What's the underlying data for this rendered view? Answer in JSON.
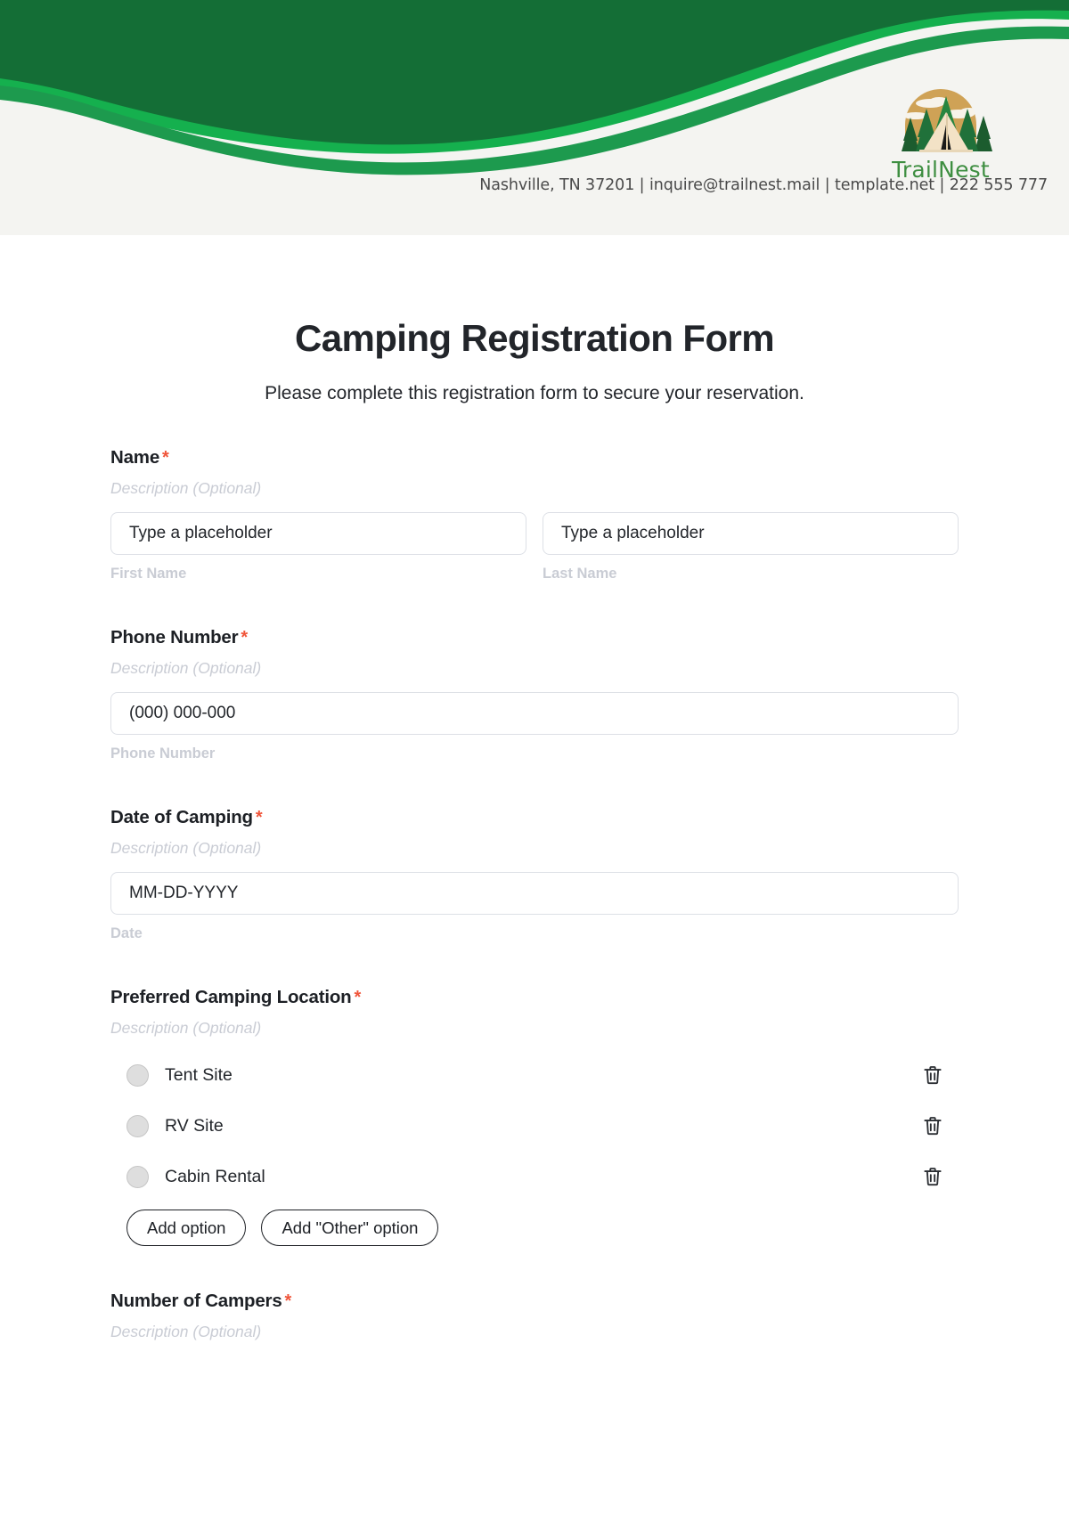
{
  "brand": {
    "name": "TrailNest",
    "logo_icon": "tent-forest-logo",
    "contact_line": "Nashville, TN 37201 | inquire@trailnest.mail | template.net | 222 555 777",
    "accent_green": "#3e8e41",
    "header_dark_green": "#155c33",
    "header_mid_green": "#1d9a4e",
    "header_bg": "#f4f4f1"
  },
  "form": {
    "title": "Camping Registration Form",
    "subtitle": "Please complete this registration form to secure your reservation.",
    "required_marker": "*",
    "description_placeholder": "Description (Optional)"
  },
  "fields": [
    {
      "label": "Name",
      "required": true,
      "description": "Description (Optional)",
      "inputs": [
        {
          "placeholder": "Type a placeholder",
          "value": "",
          "sub_label": "First Name"
        },
        {
          "placeholder": "Type a placeholder",
          "value": "",
          "sub_label": "Last Name"
        }
      ]
    },
    {
      "label": "Phone Number",
      "required": true,
      "description": "Description (Optional)",
      "inputs": [
        {
          "placeholder": "(000) 000-000",
          "value": "",
          "sub_label": "Phone Number"
        }
      ]
    },
    {
      "label": "Date of Camping",
      "required": true,
      "description": "Description (Optional)",
      "inputs": [
        {
          "placeholder": "MM-DD-YYYY",
          "value": "",
          "sub_label": "Date"
        }
      ]
    },
    {
      "label": "Preferred Camping Location",
      "required": true,
      "description": "Description (Optional)",
      "options": [
        {
          "text": "Tent Site",
          "delete_icon": "trash-icon"
        },
        {
          "text": "RV Site",
          "delete_icon": "trash-icon"
        },
        {
          "text": "Cabin Rental",
          "delete_icon": "trash-icon"
        }
      ],
      "add_option_label": "Add option",
      "add_other_option_label": "Add \"Other\" option"
    },
    {
      "label": "Number of Campers",
      "required": true,
      "description": "Description (Optional)"
    }
  ]
}
